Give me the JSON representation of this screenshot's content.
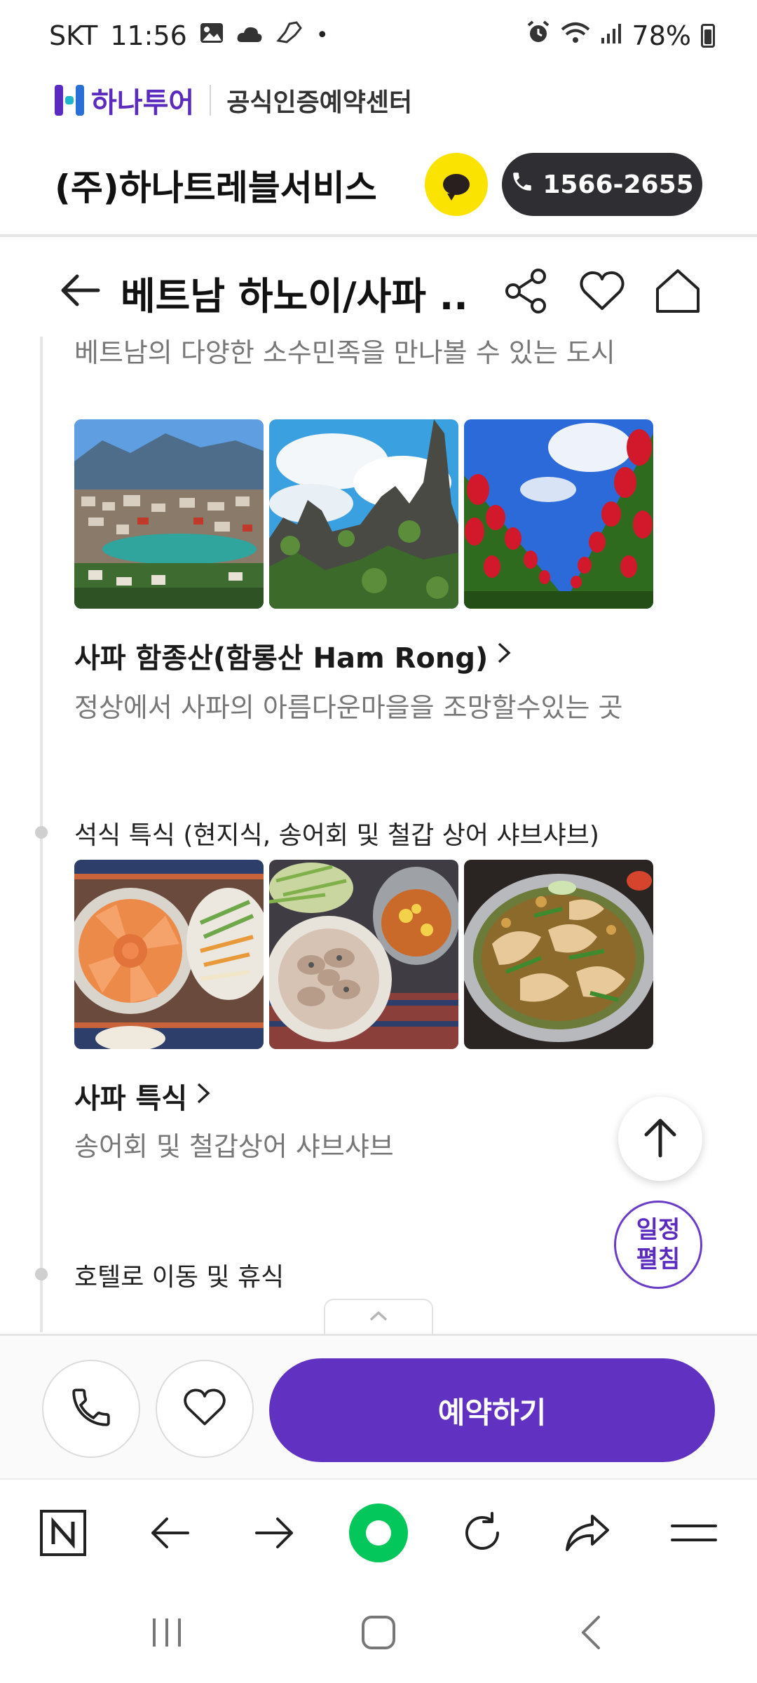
{
  "status_bar": {
    "carrier": "SKT",
    "time": "11:56",
    "battery": "78%"
  },
  "brand": {
    "name": "하나투어",
    "sub": "공식인증예약센터"
  },
  "company": {
    "name": "(주)하나트레블서비스",
    "phone": "1566-2655"
  },
  "title_bar": {
    "title": "베트남 하노이/사파 ..."
  },
  "content": {
    "cut_text": "베트남의 다양한 소수민족을 만나볼 수 있는 도시",
    "spot1": {
      "title": "사파 함종산(함롱산 Ham Rong)",
      "desc": "정상에서 사파의 아름다운마을을 조망할수있는 곳"
    },
    "meal": {
      "label": "석식 특식 (현지식, 송어회 및 철갑 상어 샤브샤브)"
    },
    "spot2": {
      "title": "사파 특식",
      "desc": "송어회 및 철갑상어 샤브샤브"
    },
    "hotel": {
      "label": "호텔로 이동 및 휴식"
    }
  },
  "fab": {
    "expand_line1": "일정",
    "expand_line2": "펼침"
  },
  "actions": {
    "reserve_label": "예약하기"
  },
  "icons": [
    "gallery-icon",
    "cloud-icon",
    "alarm-icon",
    "wifi-icon",
    "signal-icon",
    "battery-icon",
    "kakao-chat-icon",
    "phone-icon",
    "back-arrow-icon",
    "share-icon",
    "heart-icon",
    "home-icon",
    "chevron-right-icon",
    "arrow-up-icon",
    "chevron-up-icon",
    "naver-icon",
    "refresh-icon",
    "menu-icon"
  ],
  "colors": {
    "brand_purple": "#6132c2",
    "kakao_yellow": "#fbe300",
    "naver_green": "#03c75a",
    "dark_pill": "#2f2f33"
  }
}
